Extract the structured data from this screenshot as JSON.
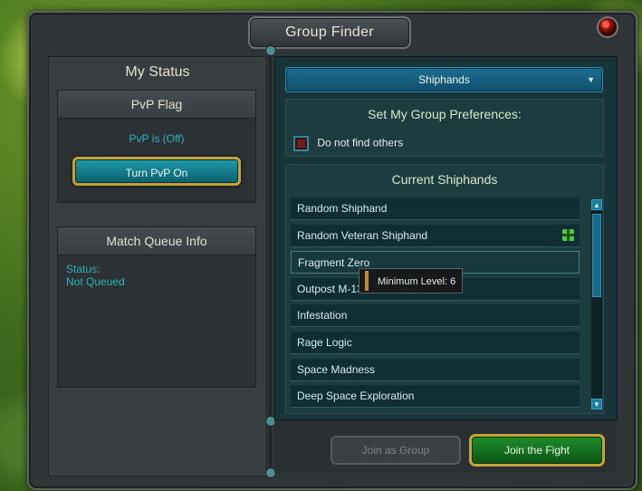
{
  "window": {
    "title": "Group Finder"
  },
  "left": {
    "my_status_title": "My Status",
    "pvp": {
      "header": "PvP Flag",
      "status": "PvP is (Off)",
      "button": "Turn PvP On"
    },
    "queue": {
      "header": "Match Queue Info",
      "status_label": "Status:",
      "status_value": "Not Queued"
    }
  },
  "right": {
    "dropdown_value": "Shiphands",
    "prefs": {
      "header": "Set My Group Preferences:",
      "checkbox_label": "Do not find others"
    },
    "current": {
      "header": "Current Shiphands",
      "items": [
        {
          "label": "Random Shiphand"
        },
        {
          "label": "Random Veteran Shiphand"
        },
        {
          "label": "Fragment Zero"
        },
        {
          "label": "Outpost M-13"
        },
        {
          "label": "Infestation"
        },
        {
          "label": "Rage Logic"
        },
        {
          "label": "Space Madness"
        },
        {
          "label": "Deep Space Exploration"
        }
      ]
    },
    "tooltip": "Minimum Level: 6"
  },
  "buttons": {
    "join_group": "Join as Group",
    "join_fight": "Join the Fight"
  },
  "icons": {
    "close": "close-icon",
    "gift": "gift-icon",
    "chevron": "chevron-down-icon"
  }
}
